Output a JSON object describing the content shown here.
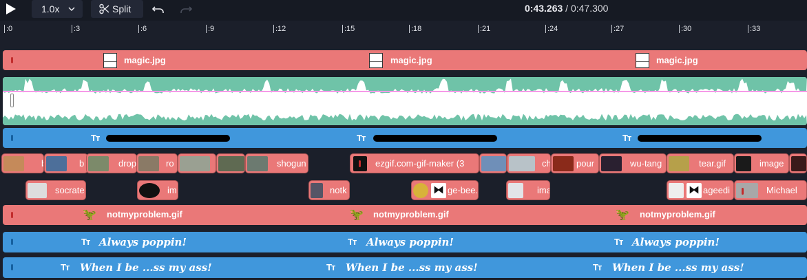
{
  "toolbar": {
    "play_icon": "play-icon",
    "speed_label": "1.0x",
    "split_label": "Split",
    "current_time": "0:43.263",
    "separator": "/",
    "total_time": "0:47.300"
  },
  "ruler": {
    "ticks": [
      ":0",
      ":3",
      ":6",
      ":9",
      ":12",
      ":15",
      ":18",
      ":21",
      ":24",
      ":27",
      ":30",
      ":33"
    ]
  },
  "tracks": {
    "image_track": {
      "clips": [
        "magic.jpg",
        "magic.jpg",
        "magic.jpg"
      ]
    },
    "audio_track": {
      "kind": "waveform"
    },
    "text_track_1": {
      "glyph": "Tт",
      "clips": [
        "",
        "",
        ""
      ]
    },
    "gif_row_1": {
      "clips": [
        "b",
        "b",
        "drop",
        "ro",
        "",
        "",
        "shogun",
        "ezgif.com-gif-maker (3",
        "",
        "ch",
        "pour",
        "wu-tang",
        "tear.gif",
        "image",
        ""
      ]
    },
    "gif_row_2": {
      "clips": [
        "socrate",
        "im",
        "notk",
        "ge-bee.",
        "ima",
        "ageedi",
        "Michael"
      ]
    },
    "notmyproblem_track": {
      "clips": [
        "notmyproblem.gif",
        "notmyproblem.gif",
        "notmyproblem.gif"
      ]
    },
    "text_track_2": {
      "glyph": "Tт",
      "clips": [
        "Always poppin!",
        "Always poppin!",
        "Always poppin!"
      ]
    },
    "text_track_3": {
      "glyph": "Tт",
      "clips": [
        "When I be ...ss my ass!",
        "When I be ...ss my ass!",
        "When I be ...ss my ass!"
      ]
    }
  },
  "colors": {
    "background": "#1b1f2a",
    "image_clip": "#ea7878",
    "text_clip": "#4097dc",
    "waveform": "#6fc3a8",
    "playhead_line": "#f59ae8"
  }
}
